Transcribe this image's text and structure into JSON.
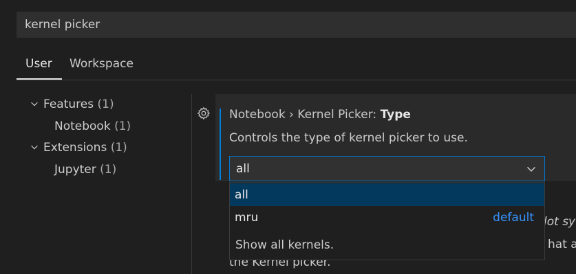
{
  "search": {
    "value": "kernel picker"
  },
  "tabs": [
    {
      "label": "User",
      "active": true
    },
    {
      "label": "Workspace",
      "active": false
    }
  ],
  "tree": [
    {
      "label": "Features",
      "count": "(1)",
      "expanded": true
    },
    {
      "label": "Notebook",
      "count": "(1)"
    },
    {
      "label": "Extensions",
      "count": "(1)",
      "expanded": true
    },
    {
      "label": "Jupyter",
      "count": "(1)"
    }
  ],
  "setting": {
    "category": "Notebook › Kernel Picker: ",
    "name": "Type",
    "description": "Controls the type of kernel picker to use.",
    "selected": "all",
    "options": [
      {
        "label": "all",
        "highlighted": true,
        "badge": ""
      },
      {
        "label": "mru",
        "highlighted": false,
        "badge": "default"
      }
    ],
    "option_description": "Show all kernels."
  },
  "background_fragments": {
    "line1": "lot sy",
    "line2": "hat ar",
    "line3": "the Kernel picker."
  },
  "colors": {
    "accent": "#007fd4",
    "selected_option": "#04395e",
    "default_badge": "#3794ff",
    "background": "#1f1f1f"
  }
}
